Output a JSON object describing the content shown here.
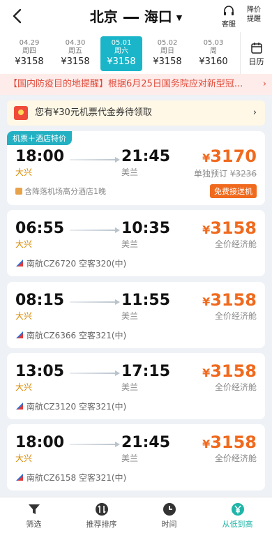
{
  "header": {
    "from": "北京",
    "to": "海口",
    "service_label": "客服",
    "price_alert_label": "降价\n提醒"
  },
  "dates": [
    {
      "date": "04.29",
      "weekday": "周四",
      "price": "¥3158"
    },
    {
      "date": "04.30",
      "weekday": "周五",
      "price": "¥3158"
    },
    {
      "date": "05.01",
      "weekday": "周六",
      "price": "¥3158",
      "selected": true
    },
    {
      "date": "05.02",
      "weekday": "周日",
      "price": "¥3158"
    },
    {
      "date": "05.03",
      "weekday": "周",
      "price": "¥3160"
    }
  ],
  "calendar_label": "日历",
  "notice": "【国内防疫目的地提醒】根据6月25日国务院应对新型冠...",
  "coupon": "您有¥30元机票代金券待领取",
  "flights": [
    {
      "tag": "机票＋酒店特价",
      "dep_time": "18:00",
      "arr_time": "21:45",
      "dep_airport": "大兴",
      "arr_airport": "美兰",
      "price": "3170",
      "desc": "单独预订",
      "orig_price": "¥3236",
      "hotel": "含降落机场高分酒店1晚",
      "badge": "免费接送机"
    },
    {
      "dep_time": "06:55",
      "arr_time": "10:35",
      "dep_airport": "大兴",
      "arr_airport": "美兰",
      "price": "3158",
      "desc": "全价经济舱",
      "airline": "南航CZ6720  空客320(中)"
    },
    {
      "dep_time": "08:15",
      "arr_time": "11:55",
      "dep_airport": "大兴",
      "arr_airport": "美兰",
      "price": "3158",
      "desc": "全价经济舱",
      "airline": "南航CZ6366  空客321(中)"
    },
    {
      "dep_time": "13:05",
      "arr_time": "17:15",
      "dep_airport": "大兴",
      "arr_airport": "美兰",
      "price": "3158",
      "desc": "全价经济舱",
      "airline": "南航CZ3120  空客321(中)"
    },
    {
      "dep_time": "18:00",
      "arr_time": "21:45",
      "dep_airport": "大兴",
      "arr_airport": "美兰",
      "price": "3158",
      "desc": "全价经济舱",
      "airline": "南航CZ6158  空客321(中)"
    }
  ],
  "currency_symbol": "¥",
  "tabs": [
    {
      "label": "筛选",
      "icon": "filter-icon"
    },
    {
      "label": "推荐排序",
      "icon": "sort-icon"
    },
    {
      "label": "时间",
      "icon": "clock-icon"
    },
    {
      "label": "从低到高",
      "icon": "yen-icon",
      "active": true
    }
  ],
  "colors": {
    "accent": "#1ab5c9",
    "price": "#f06a1e",
    "notice": "#e14a3a",
    "active_tab": "#1fb5a8"
  }
}
